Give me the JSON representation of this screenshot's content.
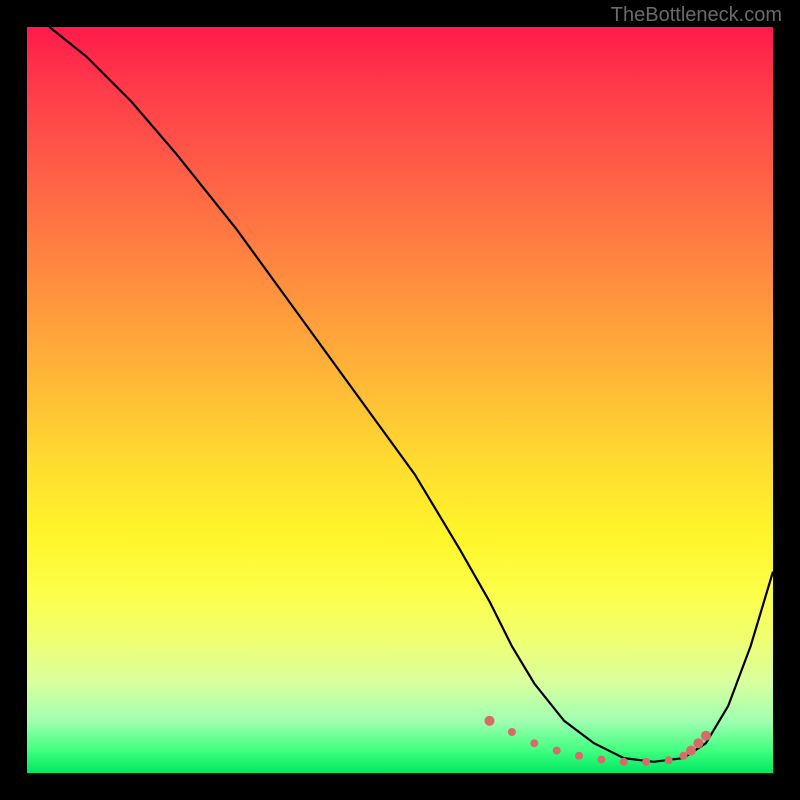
{
  "watermark": "TheBottleneck.com",
  "chart_data": {
    "type": "line",
    "title": "",
    "xlabel": "",
    "ylabel": "",
    "xlim": [
      0,
      100
    ],
    "ylim": [
      0,
      100
    ],
    "series": [
      {
        "name": "curve",
        "x": [
          3,
          8,
          14,
          20,
          28,
          36,
          44,
          52,
          58,
          62,
          65,
          68,
          72,
          76,
          80,
          84,
          88,
          91,
          94,
          97,
          100
        ],
        "values": [
          100,
          96,
          90,
          83,
          73,
          62,
          51,
          40,
          30,
          23,
          17,
          12,
          7,
          4,
          2,
          1.5,
          2,
          4,
          9,
          17,
          27
        ]
      }
    ],
    "dotted_region": {
      "x": [
        62,
        65,
        68,
        71,
        74,
        77,
        80,
        83,
        86,
        88,
        89,
        90,
        91
      ],
      "values": [
        7,
        5.5,
        4,
        3,
        2.3,
        1.8,
        1.5,
        1.5,
        1.7,
        2.3,
        3,
        4,
        5
      ],
      "color": "#d86a6a"
    },
    "gradient": {
      "stops": [
        {
          "pos": 0,
          "color": "#ff1a4a"
        },
        {
          "pos": 50,
          "color": "#ffcc30"
        },
        {
          "pos": 80,
          "color": "#fcff55"
        },
        {
          "pos": 100,
          "color": "#00e860"
        }
      ]
    }
  }
}
